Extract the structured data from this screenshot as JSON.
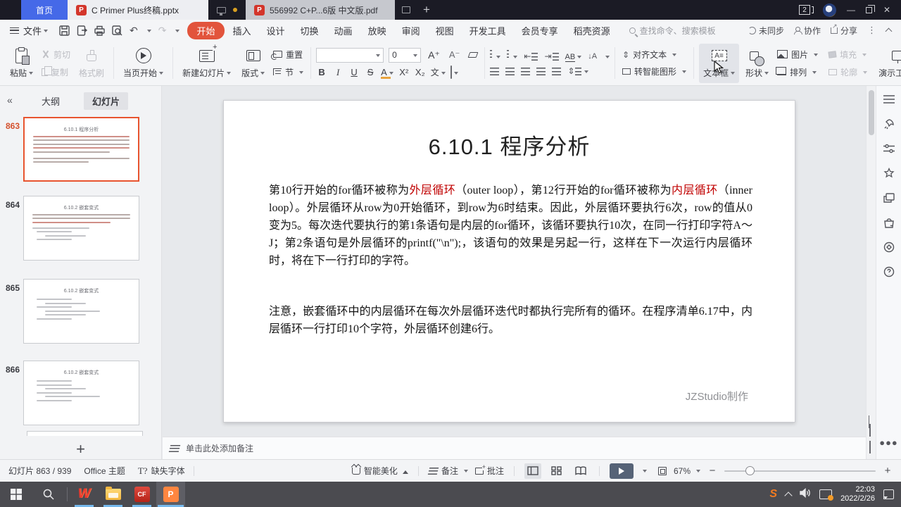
{
  "colors": {
    "accent_orange": "#e2543c",
    "home_blue": "#4569e8",
    "slide_red_text": "#c00000",
    "selection_orange": "#e8542f",
    "taskbar_underline": "#76b9ed"
  },
  "titlebar": {
    "home": "首页",
    "badge": "2",
    "tabs": [
      {
        "label": "C Primer  Plus终稿.pptx"
      },
      {
        "label": "556992 C+P...6版 中文版.pdf"
      }
    ]
  },
  "menubar": {
    "file": "文件",
    "tabs": [
      "开始",
      "插入",
      "设计",
      "切换",
      "动画",
      "放映",
      "审阅",
      "视图",
      "开发工具",
      "会员专享",
      "稻壳资源"
    ],
    "search_placeholder": "查找命令、搜索模板",
    "sync": "未同步",
    "collab": "协作",
    "share": "分享"
  },
  "ribbon": {
    "paste": "粘贴",
    "cut": "剪切",
    "copy": "复制",
    "format_painter": "格式刷",
    "play_current": "当页开始",
    "new_slide": "新建幻灯片",
    "layout": "版式",
    "reset": "重置",
    "section": "节",
    "font_name": "",
    "font_size": "0",
    "bold": "B",
    "italic": "I",
    "underline": "U",
    "strike": "S",
    "font_color": "A",
    "superscript": "X²",
    "subscript": "X₂",
    "phonetic": "文",
    "ab": "AB",
    "text_sort": "↓A",
    "align_text": "对齐文本",
    "smart_graphic": "转智能图形",
    "text_box": "文本框",
    "shapes": "形状",
    "picture": "图片",
    "fill": "填充",
    "arrange": "排列",
    "outline": "轮廓",
    "present_tools": "演示工具"
  },
  "sidebar": {
    "outline_tab": "大纲",
    "slides_tab": "幻灯片",
    "thumbs": [
      {
        "num": "863",
        "title": "6.10.1 程序分析"
      },
      {
        "num": "864",
        "title": "6.10.2 嵌套变式"
      },
      {
        "num": "865",
        "title": "6.10.2 嵌套变式"
      },
      {
        "num": "866",
        "title": "6.10.2 嵌套变式"
      }
    ],
    "add_slide": "+"
  },
  "slide": {
    "title": "6.10.1 程序分析",
    "p1": {
      "s1": "第10行开始的for循环被称为",
      "s2": "外层循环",
      "s3": "（outer loop），第12行开始的for循环被称为",
      "s4": "内层循环",
      "s5": "（inner loop）。外层循环从row为0开始循环，到row为6时结束。因此，外层循环要执行6次，row的值从0变为5。每次迭代要执行的第1条语句是内层的for循环，该循环要执行10次，在同一行打印字符A～J；第2条语句是外层循环的printf(\"\\n\");，该语句的效果是另起一行，这样在下一次运行内层循环时，将在下一行打印的字符。"
    },
    "p2": "注意，嵌套循环中的内层循环在每次外层循环迭代时都执行完所有的循环。在程序清单6.17中，内层循环一行打印10个字符，外层循环创建6行。",
    "credit": "JZStudio制作"
  },
  "notes": {
    "placeholder": "单击此处添加备注"
  },
  "statusbar": {
    "slide_counter": "幻灯片 863 / 939",
    "theme": "Office 主题",
    "missing_font": "缺失字体",
    "beautify": "智能美化",
    "notes": "备注",
    "comment": "批注",
    "zoom": "67%"
  },
  "taskbar": {
    "time": "22:03",
    "date": "2022/2/26"
  }
}
